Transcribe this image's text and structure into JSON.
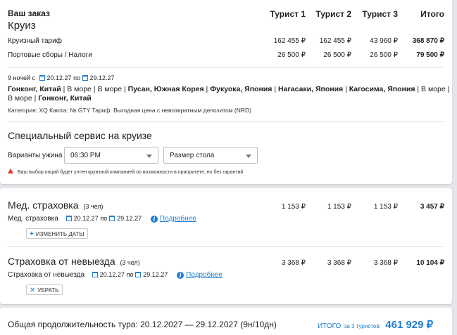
{
  "order": {
    "title": "Ваш заказ",
    "subtitle": "Круиз",
    "columns": [
      "Турист 1",
      "Турист 2",
      "Турист 3",
      "Итого"
    ],
    "rows": [
      {
        "label": "Круизный тариф",
        "values": [
          "162 455 ₽",
          "162 455 ₽",
          "43 960 ₽",
          "368 870 ₽"
        ]
      },
      {
        "label": "Портовые сборы / Налоги",
        "values": [
          "26 500 ₽",
          "26 500 ₽",
          "26 500 ₽",
          "79 500 ₽"
        ]
      }
    ],
    "nights": "9 ночей с",
    "date_from": "20.12.27",
    "date_sep": "по",
    "date_to": "29.12.27",
    "route_line1": [
      {
        "text": "Гонконг, Китай",
        "bold": true
      },
      {
        "text": " | В море | В море | ",
        "bold": false
      },
      {
        "text": "Пусан, Южная Корея",
        "bold": true
      },
      {
        "text": " | ",
        "bold": false
      },
      {
        "text": "Фукуока, Япония",
        "bold": true
      },
      {
        "text": " | ",
        "bold": false
      },
      {
        "text": "Нагасаки, Япония",
        "bold": true
      },
      {
        "text": " | ",
        "bold": false
      },
      {
        "text": "Кагосима, Япония",
        "bold": true
      },
      {
        "text": " | В море |",
        "bold": false
      }
    ],
    "route_line2": [
      {
        "text": "В море | ",
        "bold": false
      },
      {
        "text": "Гонконг, Китай",
        "bold": true
      }
    ],
    "details": "Категория: XQ  Каюта: № GTY  Тариф: Выгодная цена с невозвратным депозитом (NRD)"
  },
  "special_service": {
    "heading": "Специальный сервис на круизе",
    "dinner_label": "Варианты ужина",
    "dinner_value": "06:30 PM",
    "table_value": "Размер стола",
    "warning": "Ваш выбор опций будет учтен круизной компанией по возможности в приоритете, но без гарантий"
  },
  "medical": {
    "title": "Мед. страховка",
    "count": "(3 чел)",
    "values": [
      "1 153 ₽",
      "1 153 ₽",
      "1 153 ₽",
      "3 457 ₽"
    ],
    "label": "Мед. страховка",
    "date_from": "20.12.27",
    "date_sep": "по",
    "date_to": "29.12.27",
    "more": "Подробнее",
    "change_btn": "ИЗМЕНИТЬ ДАТЫ",
    "change_icon": "plus-icon"
  },
  "nontravel": {
    "title": "Страховка от невыезда",
    "count": "(3 чел)",
    "values": [
      "3 368 ₽",
      "3 368 ₽",
      "3 368 ₽",
      "10 104 ₽"
    ],
    "label": "Страховка от невыезда",
    "date_from": "20.12.27",
    "date_sep": "по",
    "date_to": "29.12.27",
    "more": "Подробнее",
    "remove_btn": "УБРАТЬ",
    "remove_icon": "close-icon"
  },
  "footer": {
    "duration": "Общая продолжительность тура: 20.12.2027 — 29.12.2027 (9н/10дн)",
    "total_label": "ИТОГО",
    "total_for": "за 3 туристов:",
    "total_value": "461 929 ₽"
  },
  "colors": {
    "accent": "#1e7fd3",
    "warning": "#dd3333"
  }
}
